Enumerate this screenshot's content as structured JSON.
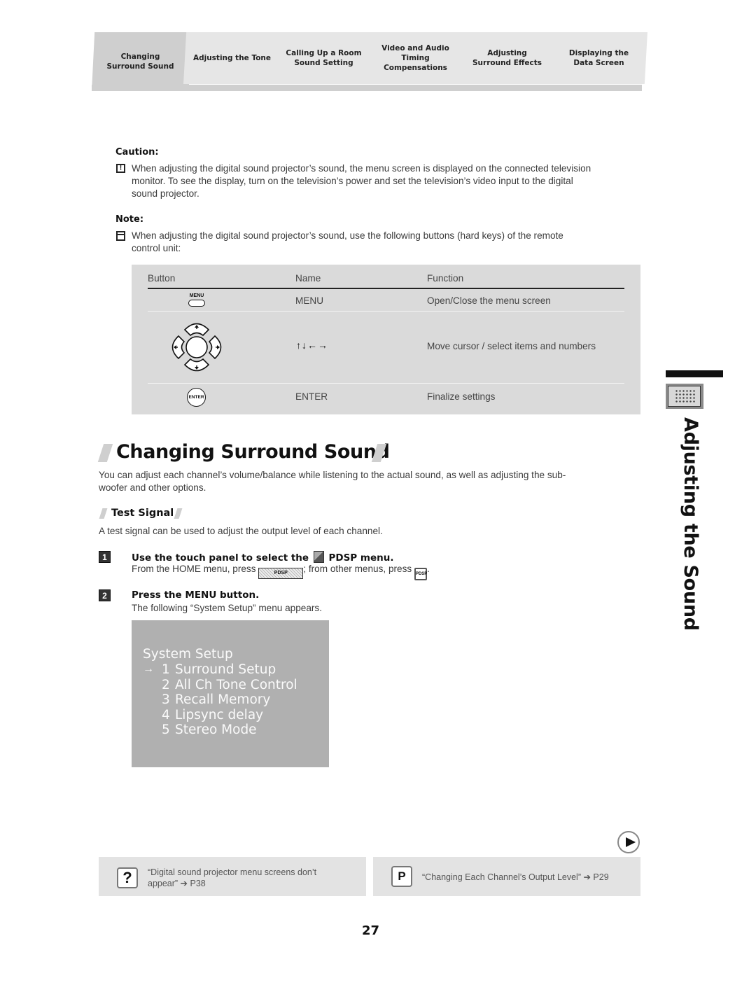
{
  "nav_tabs": [
    {
      "label_line1": "Changing",
      "label_line2": "Surround Sound",
      "active": true
    },
    {
      "label_line1": "Adjusting the Tone",
      "label_line2": "",
      "active": false
    },
    {
      "label_line1": "Calling Up a Room",
      "label_line2": "Sound Setting",
      "active": false
    },
    {
      "label_line1": "Video and Audio",
      "label_line2": "Timing",
      "label_line3": "Compensations",
      "active": false
    },
    {
      "label_line1": "Adjusting",
      "label_line2": "Surround Effects",
      "active": false
    },
    {
      "label_line1": "Displaying the",
      "label_line2": "Data Screen",
      "active": false
    }
  ],
  "caution": {
    "heading": "Caution:",
    "icon": "exclamation-icon",
    "line1": "When adjusting the digital sound projector’s sound, the menu screen is displayed on the connected television",
    "line2": "monitor. To see the display, turn on the television’s power and set the television’s video input to the digital",
    "line3": "sound projector."
  },
  "note": {
    "heading": "Note:",
    "icon": "note-icon",
    "line1": "When adjusting the digital sound projector’s sound, use the following buttons (hard keys) of the remote",
    "line2": "control unit:"
  },
  "button_table": {
    "headers": [
      "Button",
      "Name",
      "Function"
    ],
    "rows": [
      {
        "button_icon": "menu-button-icon",
        "button_text": "MENU",
        "name": "MENU",
        "function": "Open/Close the menu screen"
      },
      {
        "button_icon": "cursor-pad-icon",
        "button_text": "",
        "name": "↑↓←→",
        "function": "Move cursor / select items and numbers"
      },
      {
        "button_icon": "enter-button-icon",
        "button_text": "ENTER",
        "name": "ENTER",
        "function": "Finalize settings"
      }
    ]
  },
  "side_tab": {
    "title": "Adjusting the Sound",
    "icon": "speaker-grid-icon"
  },
  "section": {
    "title": "Changing Surround Sound",
    "intro_line1": "You can adjust each channel’s volume/balance while listening to the actual sound, as well as adjusting the sub-",
    "intro_line2": "woofer and other options.",
    "subsection_title": "Test Signal",
    "subsection_text": "A test signal can be used to adjust the output level of each channel."
  },
  "steps": [
    {
      "number": "1",
      "title_before_icon": "Use the touch panel to select the",
      "title_after_icon": "PDSP menu.",
      "text_before": "From the HOME menu, press",
      "home_button_label": "PDSP",
      "text_middle": "; from other menus, press",
      "small_button_label": "PDSP",
      "text_after": "."
    },
    {
      "number": "2",
      "title": "Press the MENU button.",
      "text": "The following “System Setup” menu appears."
    }
  ],
  "system_setup_screen": {
    "title": "System Setup",
    "cursor_symbol": "→",
    "items": [
      {
        "num": "1",
        "label": "Surround Setup",
        "selected": true
      },
      {
        "num": "2",
        "label": "All Ch Tone Control",
        "selected": false
      },
      {
        "num": "3",
        "label": "Recall Memory",
        "selected": false
      },
      {
        "num": "4",
        "label": "Lipsync delay",
        "selected": false
      },
      {
        "num": "5",
        "label": "Stereo Mode",
        "selected": false
      }
    ]
  },
  "references": [
    {
      "icon": "question-icon",
      "icon_glyph": "?",
      "line1": "“Digital sound projector menu screens don’t",
      "line2": "appear” ➔ P38"
    },
    {
      "icon": "page-reference-icon",
      "icon_glyph": "P",
      "line1": "“Changing Each Channel’s Output Level” ➔ P29",
      "line2": ""
    }
  ],
  "page_number": "27"
}
